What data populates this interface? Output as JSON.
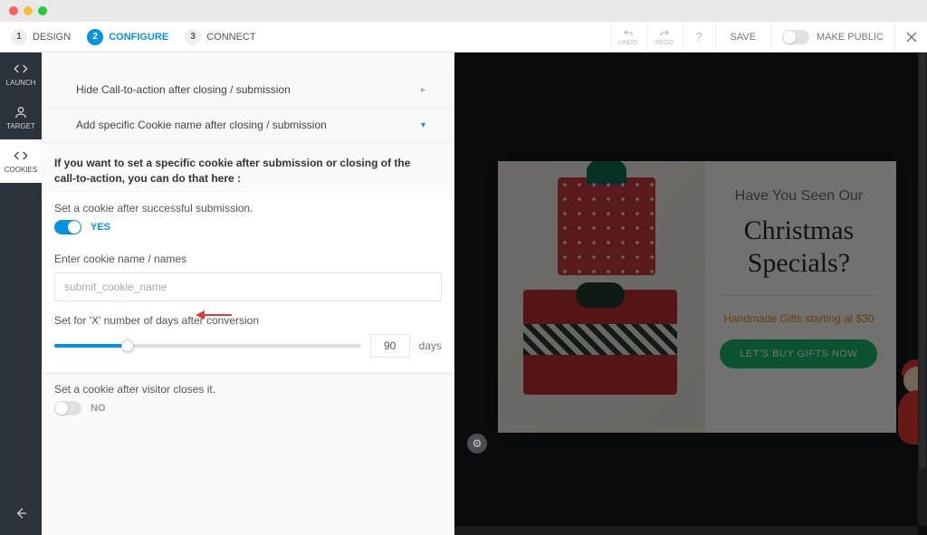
{
  "steps": [
    {
      "num": "1",
      "label": "DESIGN"
    },
    {
      "num": "2",
      "label": "CONFIGURE"
    },
    {
      "num": "3",
      "label": "CONNECT"
    }
  ],
  "toolbar": {
    "undo": "UNDO",
    "redo": "REDO",
    "save": "SAVE",
    "make_public": "MAKE PUBLIC"
  },
  "rail": {
    "launch": "LAUNCH",
    "target": "TARGET",
    "cookies": "COOKIES"
  },
  "panel": {
    "hide_cta": "Hide Call-to-action after closing / submission",
    "add_cookie": "Add specific Cookie name after closing / submission",
    "intro": "If you want to set a specific cookie after submission or closing of the call-to-action, you can do that here :",
    "set_after_submit": "Set a cookie after successful submission.",
    "yes": "YES",
    "cookie_label": "Enter cookie name / names",
    "cookie_placeholder": "submit_cookie_name",
    "days_label": "Set for 'X' number of days after conversion",
    "days_value": "90",
    "days_unit": "days",
    "set_after_close": "Set a cookie after visitor closes it.",
    "no": "NO"
  },
  "popup": {
    "line1": "Have You Seen Our",
    "line2": "Christmas",
    "line3": "Specials?",
    "line4": "Handmade Gifts starting at $30",
    "cta": "LET'S BUY GIFTS NOW"
  }
}
